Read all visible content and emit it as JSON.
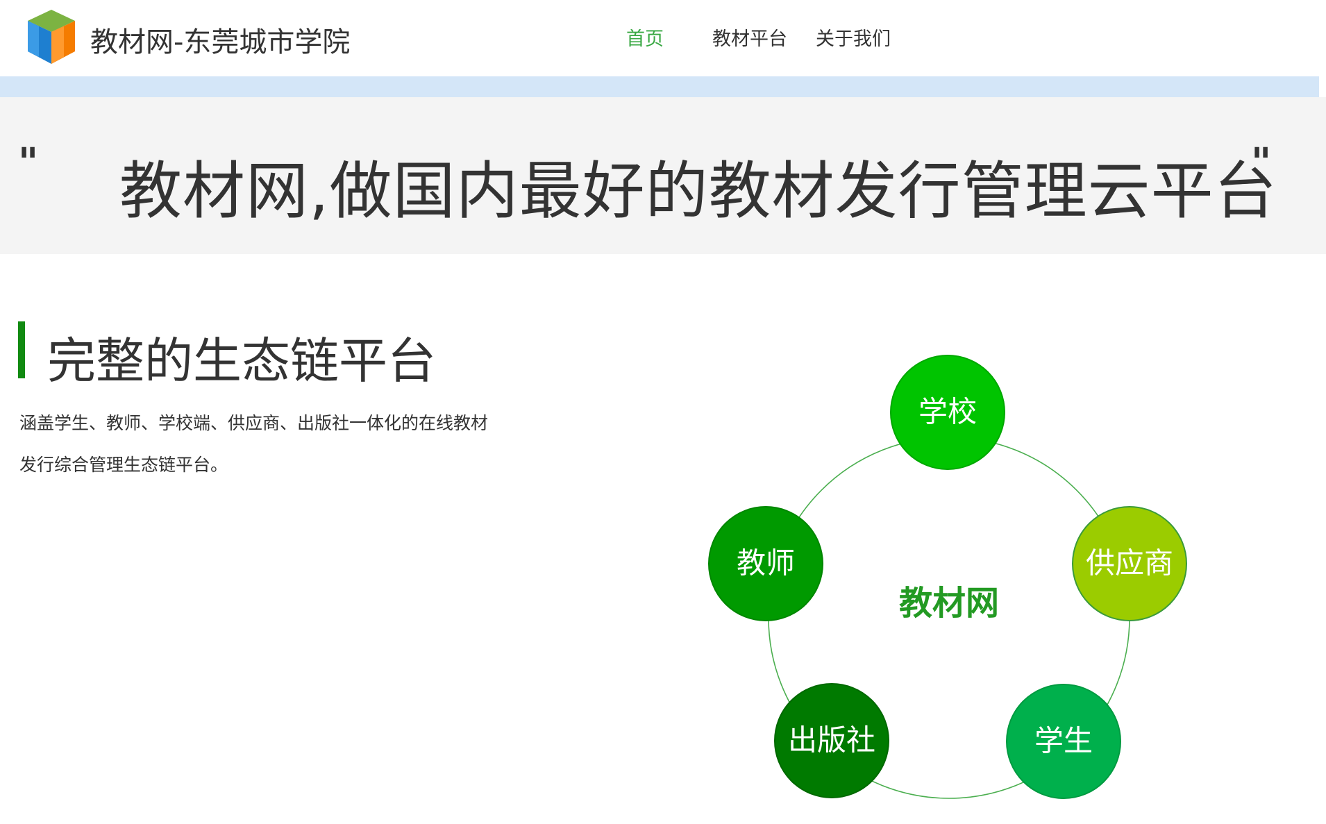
{
  "header": {
    "site_title": "教材网-东莞城市学院",
    "nav": [
      {
        "label": "首页",
        "active": true
      },
      {
        "label": "教材平台",
        "active": false
      },
      {
        "label": "关于我们",
        "active": false
      }
    ]
  },
  "hero": {
    "open_quote": "\"",
    "slogan": "教材网,做国内最好的教材发行管理云平台",
    "close_quote": "\""
  },
  "section": {
    "title": "完整的生态链平台",
    "description": "涵盖学生、教师、学校端、供应商、出版社一体化的在线教材发行综合管理生态链平台。"
  },
  "ecosystem": {
    "center": "教材网",
    "nodes": [
      {
        "label": "学校",
        "color": "#00c400"
      },
      {
        "label": "供应商",
        "color": "#9bcc00"
      },
      {
        "label": "学生",
        "color": "#00b04c"
      },
      {
        "label": "出版社",
        "color": "#007a00"
      },
      {
        "label": "教师",
        "color": "#009a00"
      }
    ],
    "ring_color": "#4caf50",
    "center_color": "#239a23"
  },
  "colors": {
    "nav_active": "#3aa844",
    "accent_bar": "#118a11",
    "hero_background": "#f4f4f4",
    "strip_background": "#d4e6f8"
  }
}
